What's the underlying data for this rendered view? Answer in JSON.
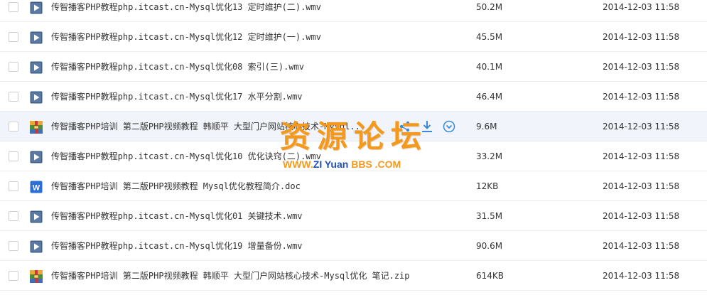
{
  "files": [
    {
      "name": "传智播客PHP教程php.itcast.cn-Mysql优化13 定时维护(二).wmv",
      "size": "50.2M",
      "date": "2014-12-03 11:58",
      "icon": "video-file-icon"
    },
    {
      "name": "传智播客PHP教程php.itcast.cn-Mysql优化12 定时维护(一).wmv",
      "size": "45.5M",
      "date": "2014-12-03 11:58",
      "icon": "video-file-icon"
    },
    {
      "name": "传智播客PHP教程php.itcast.cn-Mysql优化08 索引(三).wmv",
      "size": "40.1M",
      "date": "2014-12-03 11:58",
      "icon": "video-file-icon"
    },
    {
      "name": "传智播客PHP教程php.itcast.cn-Mysql优化17 水平分割.wmv",
      "size": "46.4M",
      "date": "2014-12-03 11:58",
      "icon": "video-file-icon"
    },
    {
      "name": "传智播客PHP培训 第二版PHP视频教程 韩顺平 大型门户网站核心技术-Mysql...",
      "size": "9.6M",
      "date": "2014-12-03 11:58",
      "icon": "archive-file-icon",
      "hovered": true
    },
    {
      "name": "传智播客PHP教程php.itcast.cn-Mysql优化10 优化诀窍(二).wmv",
      "size": "33.2M",
      "date": "2014-12-03 11:58",
      "icon": "video-file-icon"
    },
    {
      "name": "传智播客PHP培训 第二版PHP视频教程 Mysql优化教程简介.doc",
      "size": "12KB",
      "date": "2014-12-03 11:58",
      "icon": "word-file-icon"
    },
    {
      "name": "传智播客PHP教程php.itcast.cn-Mysql优化01 关键技术.wmv",
      "size": "31.5M",
      "date": "2014-12-03 11:58",
      "icon": "video-file-icon"
    },
    {
      "name": "传智播客PHP教程php.itcast.cn-Mysql优化19 增量备份.wmv",
      "size": "90.6M",
      "date": "2014-12-03 11:58",
      "icon": "video-file-icon"
    },
    {
      "name": "传智播客PHP培训 第二版PHP视频教程 韩顺平 大型门户网站核心技术-Mysql优化 笔记.zip",
      "size": "614KB",
      "date": "2014-12-03 11:58",
      "icon": "archive-file-icon"
    }
  ],
  "row_actions": [
    {
      "icon": "share-icon"
    },
    {
      "icon": "download-icon"
    },
    {
      "icon": "more-dropdown-icon"
    }
  ],
  "watermark": {
    "title": "资源论坛",
    "url_parts": [
      {
        "text": "WWW.",
        "color": "#f39a1e"
      },
      {
        "text": "ZI",
        "color": "#1f4fb8"
      },
      {
        "text": " Yuan ",
        "color": "#1f4fb8"
      },
      {
        "text": "BBS",
        "color": "#f39a1e"
      },
      {
        "text": " .COM",
        "color": "#f39a1e"
      }
    ]
  },
  "colors": {
    "video_icon": "#3f5f86",
    "word_icon": "#2b6fd6",
    "action_icon": "#3b8ad9",
    "watermark_orange": "#f39a1e",
    "watermark_blue": "#1f4fb8"
  }
}
